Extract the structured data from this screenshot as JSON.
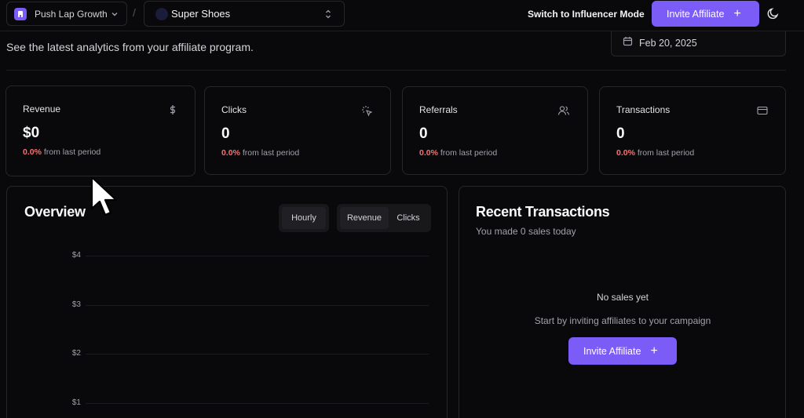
{
  "topbar": {
    "org_name": "Push Lap Growth",
    "project_name": "Super Shoes",
    "breadcrumb_separator": "/",
    "switch_mode_label": "Switch to Influencer Mode",
    "invite_label": "Invite Affiliate",
    "invite_icon": "+"
  },
  "header": {
    "subtitle": "See the latest analytics from your affiliate program.",
    "date": "Feb 20, 2025"
  },
  "stats": [
    {
      "label": "Revenue",
      "value": "$0",
      "change_pct": "0.0%",
      "change_text": " from last period",
      "icon": "dollar-icon"
    },
    {
      "label": "Clicks",
      "value": "0",
      "change_pct": "0.0%",
      "change_text": " from last period",
      "icon": "pointer-click-icon"
    },
    {
      "label": "Referrals",
      "value": "0",
      "change_pct": "0.0%",
      "change_text": " from last period",
      "icon": "users-icon"
    },
    {
      "label": "Transactions",
      "value": "0",
      "change_pct": "0.0%",
      "change_text": " from last period",
      "icon": "credit-card-icon"
    }
  ],
  "overview": {
    "title": "Overview",
    "interval_label": "Hourly",
    "metric_options": [
      "Revenue",
      "Clicks"
    ],
    "y_ticks": [
      "$4",
      "$3",
      "$2",
      "$1"
    ]
  },
  "recent": {
    "title": "Recent Transactions",
    "subtitle": "You made 0 sales today",
    "empty_title": "No sales yet",
    "empty_subtitle": "Start by inviting affiliates to your campaign",
    "invite_label": "Invite Affiliate",
    "invite_icon": "+"
  },
  "colors": {
    "accent": "#7c5cf6",
    "negative": "#f87171",
    "background": "#09090b",
    "border": "#27272a"
  }
}
